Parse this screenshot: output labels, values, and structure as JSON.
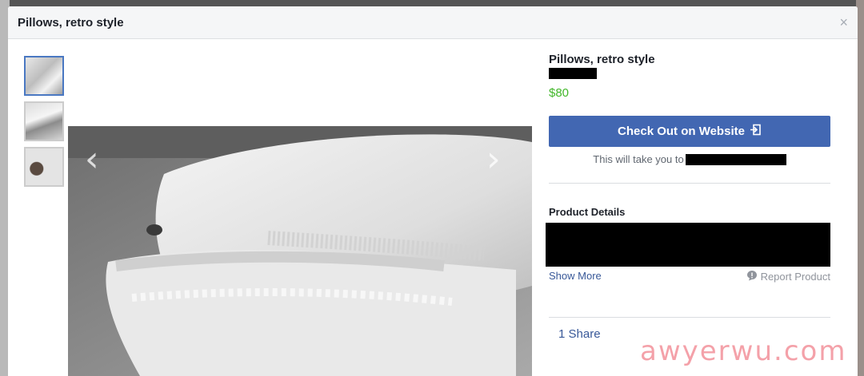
{
  "modal": {
    "title": "Pillows, retro style",
    "close_icon": "×"
  },
  "product": {
    "title": "Pillows, retro style",
    "price": "$80",
    "checkout_label": "Check Out on Website",
    "takeyou_text": "This will take you to",
    "details_heading": "Product Details",
    "show_more": "Show More",
    "report": "Report Product",
    "share": "1 Share"
  },
  "gallery": {
    "prev_arrow": "‹",
    "next_arrow": "›",
    "thumbnails": [
      "thumb-1",
      "thumb-2",
      "thumb-3"
    ]
  },
  "watermark": "awyerwu.com",
  "colors": {
    "accent": "#4267b2",
    "price": "#42b72a",
    "link": "#385898",
    "watermark": "#f0828c"
  },
  "icons": {
    "checkout": "exit-icon",
    "report": "report-icon",
    "close": "close-icon"
  }
}
